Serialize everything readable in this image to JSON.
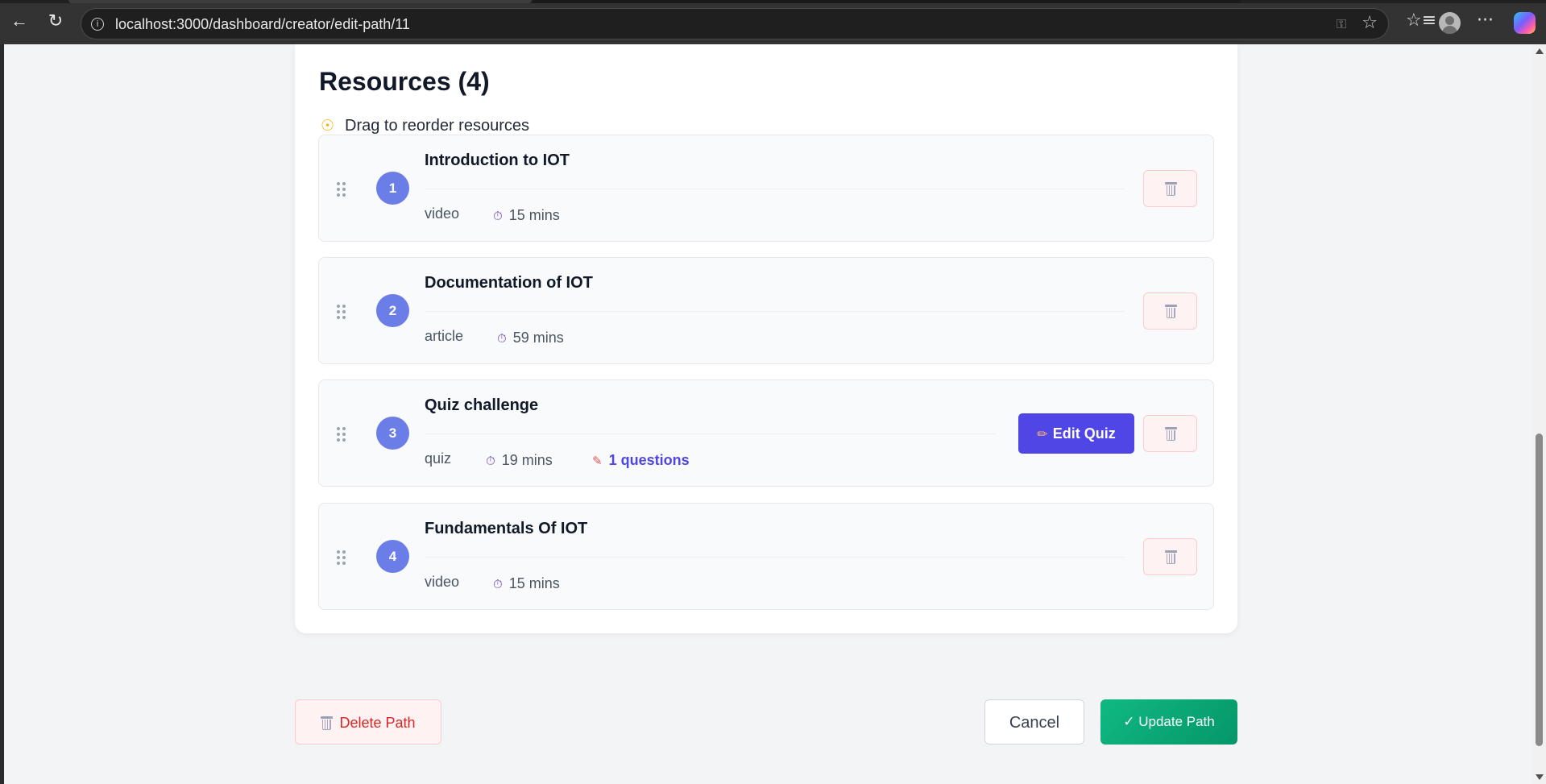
{
  "browser": {
    "url": "localhost:3000/dashboard/creator/edit-path/11",
    "icons": {
      "back": "arrow-left-icon",
      "reload": "reload-icon",
      "site_info": "info-icon",
      "password": "key-icon",
      "favorite": "star-icon",
      "favorites": "favorites-icon",
      "profile": "profile-icon",
      "more": "more-icon",
      "copilot": "copilot-icon"
    }
  },
  "resources": {
    "title": "Resources (4)",
    "hint": "Drag to reorder resources",
    "items": [
      {
        "number": "1",
        "title": "Introduction to IOT",
        "type": "video",
        "duration": "15 mins"
      },
      {
        "number": "2",
        "title": "Documentation of IOT",
        "type": "article",
        "duration": "59 mins"
      },
      {
        "number": "3",
        "title": "Quiz challenge",
        "type": "quiz",
        "duration": "19 mins",
        "questions": "1 questions",
        "edit_label": "Edit Quiz"
      },
      {
        "number": "4",
        "title": "Fundamentals Of IOT",
        "type": "video",
        "duration": "15 mins"
      }
    ]
  },
  "actions": {
    "delete_label": "Delete Path",
    "cancel_label": "Cancel",
    "update_label": "✓ Update Path"
  },
  "colors": {
    "badge": "#6b7ee8",
    "edit_quiz": "#4f46e5",
    "update": "#10b981",
    "danger": "#dc2626"
  }
}
